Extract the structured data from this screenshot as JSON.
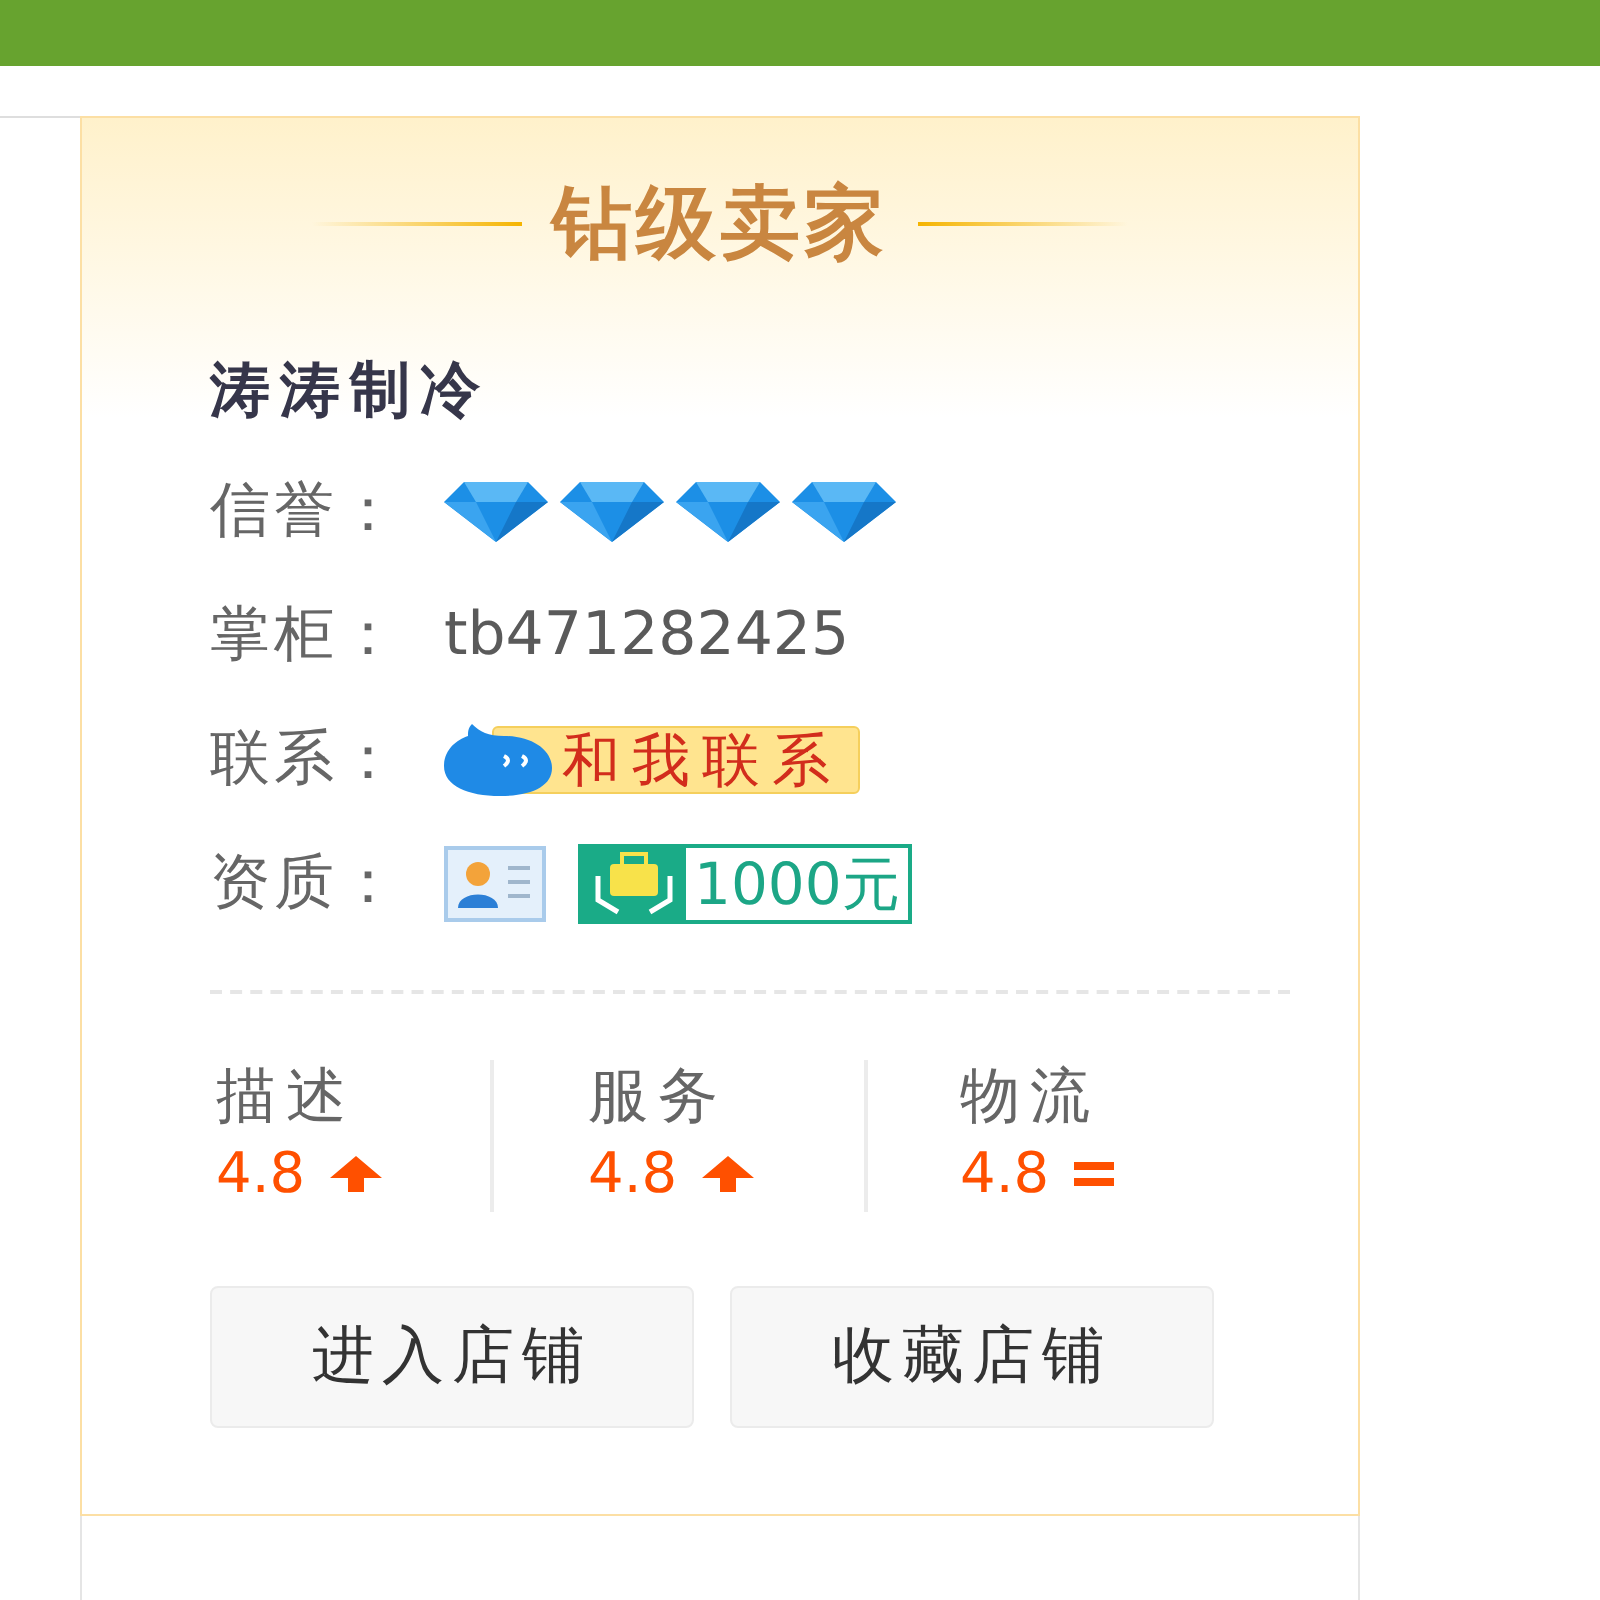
{
  "seller_card": {
    "title": "钻级卖家",
    "shop_name": "涛涛制冷",
    "credit": {
      "label": "信誉：",
      "stars": 4
    },
    "shopkeeper": {
      "label": "掌柜：",
      "value": "tb471282425"
    },
    "contact": {
      "label": "联系：",
      "button": "和我联系"
    },
    "qualification": {
      "label": "资质：",
      "deposit": "1000元"
    },
    "ratings": [
      {
        "label": "描述",
        "score": "4.8",
        "kind": "up"
      },
      {
        "label": "服务",
        "score": "4.8",
        "kind": "up"
      },
      {
        "label": "物流",
        "score": "4.8",
        "kind": "flat"
      }
    ],
    "buttons": [
      "进入店铺",
      "收藏店铺"
    ]
  }
}
